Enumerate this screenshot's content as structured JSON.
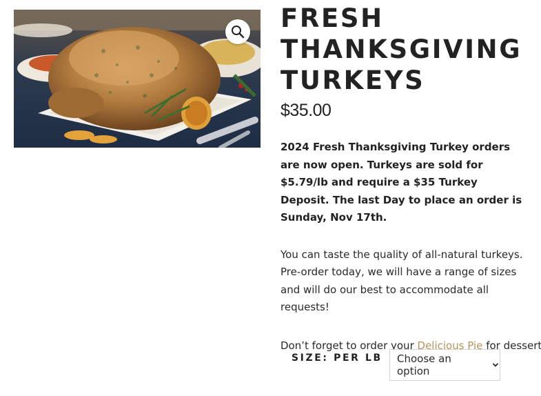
{
  "product": {
    "title_lines": [
      "FRESH",
      "THANKSGIVING",
      "TURKEYS"
    ],
    "price": "$35.00",
    "description_bold": "2024 Fresh Thanksgiving Turkey orders are now open. Turkeys are sold for $5.79/lb and require a $35 Turkey Deposit.  The last Day to place an order is Sunday, Nov 17th.",
    "description": "You can taste the quality of all-natural turkeys. Pre-order today, we will have a range of sizes and will do our best to accommodate all requests!",
    "pie_prefix": "Don’t forget to order your ",
    "pie_link": "Delicious Pie",
    "pie_suffix": " for dessert."
  },
  "variation": {
    "label": "SIZE: PER LB",
    "select_value": "Choose an option"
  },
  "icons": {
    "zoom": "magnifier-icon",
    "select_arrow": "chevron-down-icon"
  },
  "colors": {
    "link": "#b8925a",
    "text": "#222222"
  }
}
